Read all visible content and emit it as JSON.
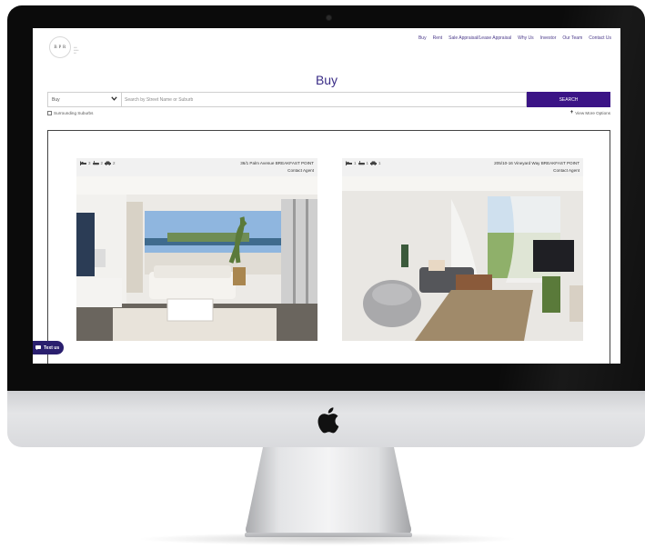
{
  "nav": {
    "items": [
      "Buy",
      "Rent",
      "Sale Appraisal/Lease Appraisal",
      "Why Us",
      "Investor",
      "Our Team",
      "Contact Us"
    ]
  },
  "logo": {
    "mark": "B P R"
  },
  "page": {
    "title": "Buy"
  },
  "search": {
    "type_value": "Buy",
    "placeholder": "Search by Street Name or Suburb",
    "button_label": "SEARCH"
  },
  "options": {
    "surrounding_label": "Surrounding Suburbs",
    "more_label": "View More Options"
  },
  "listings": [
    {
      "beds": "3",
      "baths": "2",
      "cars": "2",
      "address": "36/1 Palm Avenue BREAKFAST POINT",
      "price": "Contact Agent"
    },
    {
      "beds": "1",
      "baths": "1",
      "cars": "1",
      "address": "205/10-16 Vineyard Way BREAKFAST POINT",
      "price": "Contact Agent"
    }
  ],
  "chat": {
    "label": "Text us"
  },
  "colors": {
    "brand": "#3b1486",
    "title": "#3a2d87",
    "chat": "#2a1f6e"
  },
  "icons": [
    "bed-icon",
    "bath-icon",
    "car-icon",
    "chevron-down-icon",
    "plus-icon",
    "chat-icon",
    "apple-logo-icon",
    "camera-icon"
  ]
}
